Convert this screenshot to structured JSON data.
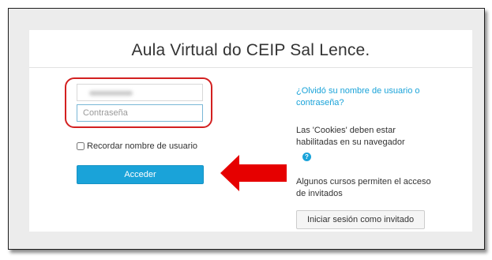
{
  "page": {
    "title": "Aula Virtual do CEIP Sal Lence."
  },
  "login": {
    "username_value": "",
    "password_placeholder": "Contraseña",
    "remember_label": "Recordar nombre de usuario",
    "login_button": "Acceder"
  },
  "info": {
    "forgot_link": "¿Olvidó su nombre de usuario o contraseña?",
    "cookies_text": "Las 'Cookies' deben estar habilitadas en su navegador",
    "help_icon_glyph": "?",
    "guests_text": "Algunos cursos permiten el acceso de invitados",
    "guest_button": "Iniciar sesión como invitado"
  },
  "colors": {
    "accent": "#1aa3d9",
    "highlight": "#d32020"
  },
  "icons": {
    "help": "question-circle-icon",
    "annotation_arrow": "left-arrow-icon"
  }
}
